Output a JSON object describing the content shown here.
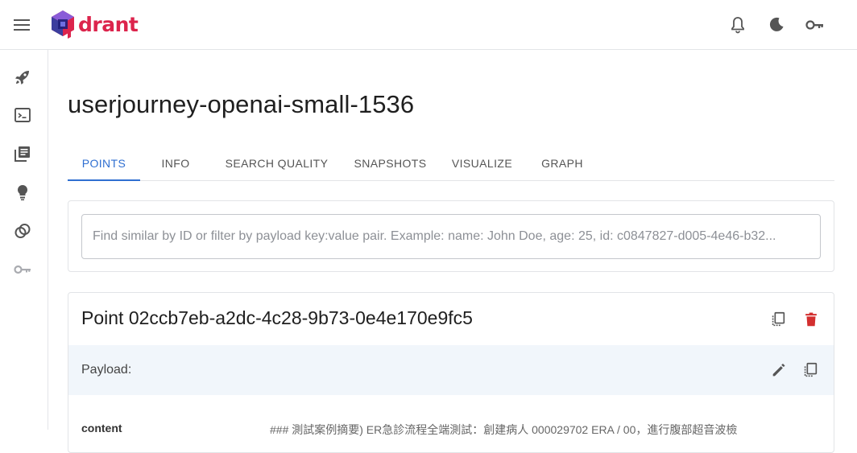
{
  "app": {
    "logo_text": "drant",
    "brand_color": "#dc244c",
    "accent_color": "#2f6fd1",
    "danger_color": "#d32f2f"
  },
  "header": {
    "icons": [
      "menu-icon",
      "notifications-bell-icon",
      "dark-mode-moon-icon",
      "api-key-icon"
    ]
  },
  "sidebar": {
    "items": [
      {
        "name": "welcome",
        "icon": "rocket-icon"
      },
      {
        "name": "console",
        "icon": "terminal-icon"
      },
      {
        "name": "collections",
        "icon": "library-icon"
      },
      {
        "name": "tutorial",
        "icon": "lightbulb-icon"
      },
      {
        "name": "datasets",
        "icon": "rings-icon"
      },
      {
        "name": "access-tokens",
        "icon": "key-icon"
      }
    ]
  },
  "collection": {
    "title": "userjourney-openai-small-1536",
    "tabs": [
      "POINTS",
      "INFO",
      "SEARCH QUALITY",
      "SNAPSHOTS",
      "VISUALIZE",
      "GRAPH"
    ],
    "active_tab": "POINTS"
  },
  "search": {
    "placeholder": "Find similar by ID or filter by payload key:value pair. Example: name: John Doe, age: 25, id: c0847827-d005-4e46-b32...",
    "value": ""
  },
  "point": {
    "title": "Point 02ccb7eb-a2dc-4c28-9b73-0e4e170e9fc5",
    "payload_label": "Payload:",
    "payload_key": "content",
    "payload_value": "### 測試案例摘要) ER急診流程全端測試：創建病人 000029702 ERA / 00，進行腹部超音波檢"
  }
}
